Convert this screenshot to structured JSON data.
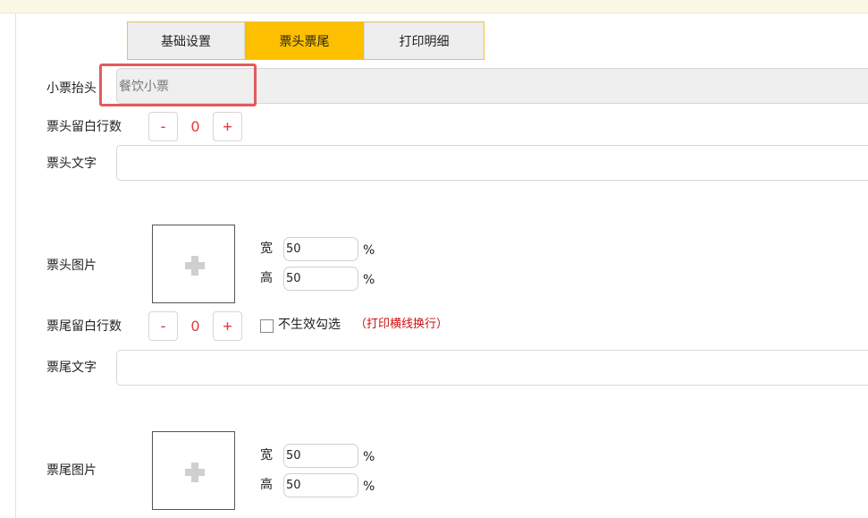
{
  "tabs": [
    {
      "label": "基础设置"
    },
    {
      "label": "票头票尾",
      "active": true
    },
    {
      "label": "打印明细"
    }
  ],
  "form": {
    "receipt_title": {
      "label": "小票抬头",
      "value": "餐饮小票"
    },
    "header_blank_lines": {
      "label": "票头留白行数",
      "value": "0",
      "minus": "-",
      "plus": "+"
    },
    "header_text": {
      "label": "票头文字",
      "value": ""
    },
    "header_image": {
      "label": "票头图片",
      "width_label": "宽",
      "width": "50",
      "height_label": "高",
      "height": "50",
      "unit": "%"
    },
    "footer_blank_lines": {
      "label": "票尾留白行数",
      "value": "0",
      "minus": "-",
      "plus": "+",
      "checkbox_label": "不生效勾选",
      "checkbox_note": "（打印横线换行）",
      "checked": false
    },
    "footer_text": {
      "label": "票尾文字",
      "value": ""
    },
    "footer_image": {
      "label": "票尾图片",
      "width_label": "宽",
      "width": "50",
      "height_label": "高",
      "height": "50",
      "unit": "%"
    }
  },
  "colors": {
    "accent": "#fcc000",
    "highlight": "#e35a5e",
    "stepper_text": "#e4393c",
    "note": "#cc1111"
  }
}
